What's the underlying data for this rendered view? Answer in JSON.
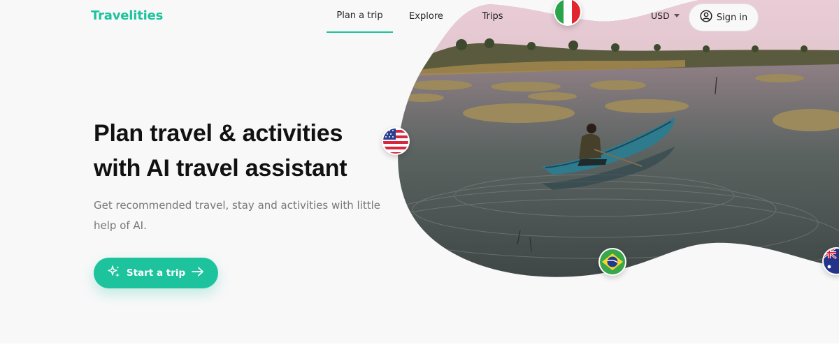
{
  "header": {
    "logo": "Travelities",
    "tabs": [
      {
        "label": "Plan a trip",
        "active": true
      },
      {
        "label": "Explore",
        "active": false
      },
      {
        "label": "Trips",
        "active": false
      }
    ],
    "currency": "USD",
    "signin_label": "Sign in",
    "icons": {
      "signin": "user-circle-icon",
      "currency_caret": "caret-down-icon"
    }
  },
  "hero": {
    "title_line1": "Plan travel & activities",
    "title_line2": "with AI travel assistant",
    "subtitle_line1": "Get recommended travel, stay and activities with little",
    "subtitle_line2": "help of AI.",
    "cta_label": "Start a trip",
    "cta_icons": [
      "sparkles-icon",
      "arrow-right-icon"
    ],
    "image": "person paddling a canoe on a calm lake with grass islands",
    "flags": [
      "italy-flag-icon",
      "usa-flag-icon",
      "brazil-flag-icon",
      "australia-flag-icon"
    ]
  },
  "colors": {
    "accent": "#1cc39d",
    "background": "#f8f8f9",
    "text": "#111111",
    "muted_text": "#777777"
  }
}
